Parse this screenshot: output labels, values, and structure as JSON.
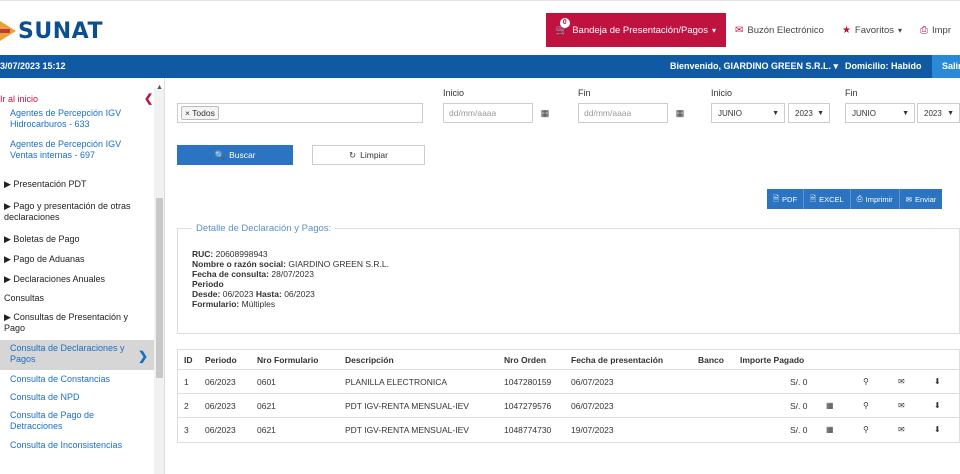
{
  "header": {
    "logo": "SUNAT",
    "nav": [
      {
        "label": "Bandeja de Presentación/Pagos",
        "badge": "0",
        "caret": "▾"
      },
      {
        "label": "Buzón Electrónico"
      },
      {
        "label": "Favoritos",
        "caret": "▾"
      },
      {
        "label": "Impr"
      }
    ]
  },
  "status": {
    "datetime": "3/07/2023 15:12",
    "welcome": "Bienvenido, GIARDINO GREEN S.R.L. ▾",
    "domicilio": "Domicilio: Habido",
    "salir": "Salir"
  },
  "sidebar": {
    "back": "Ir al inicio",
    "items": [
      {
        "label": "Agentes de Percepción IGV Hidrocarburos - 633"
      },
      {
        "label": "Agentes de Percepción IGV Ventas internas - 697"
      },
      {
        "label": "▶ Presentación PDT"
      },
      {
        "label": "▶ Pago y presentación de otras declaraciones"
      },
      {
        "label": "▶ Boletas de Pago"
      },
      {
        "label": "▶ Pago de Aduanas"
      },
      {
        "label": "▶ Declaraciones Anuales"
      },
      {
        "label": "Consultas"
      },
      {
        "label": "▶ Consultas de Presentación y Pago"
      },
      {
        "label": "Consulta de Declaraciones y Pagos"
      },
      {
        "label": "Consulta de Constancias"
      },
      {
        "label": "Consulta de NPD"
      },
      {
        "label": "Consulta de Pago de Detracciones"
      },
      {
        "label": "Consulta de Inconsistencias"
      }
    ]
  },
  "filters": {
    "tag": "× Todos",
    "inicio_label": "Inicio",
    "fin_label": "Fin",
    "inicio2_label": "Inicio",
    "fin2_label": "Fin",
    "date_placeholder": "dd/mm/aaaa",
    "month_from": "JUNIO",
    "year_from": "2023",
    "month_to": "JUNIO",
    "year_to": "2023",
    "buscar": "Buscar",
    "limpiar": "Limpiar"
  },
  "export": {
    "pdf": "PDF",
    "excel": "EXCEL",
    "imprimir": "Imprimir",
    "enviar": "Enviar"
  },
  "detail": {
    "legend": "Detalle de Declaración y Pagos:",
    "ruc_label": "RUC:",
    "ruc": "20608998943",
    "nombre_label": "Nombre o razón social:",
    "nombre": "GIARDINO GREEN S.R.L.",
    "fecha_label": "Fecha de consulta:",
    "fecha": "28/07/2023",
    "periodo_label": "Periodo",
    "desde_label": "Desde:",
    "desde": "06/2023",
    "hasta_label": "Hasta:",
    "hasta": "06/2023",
    "formulario_label": "Formulario:",
    "formulario": "Múltiples"
  },
  "table": {
    "headers": [
      "ID",
      "Periodo",
      "Nro Formulario",
      "Descripción",
      "Nro Orden",
      "Fecha de presentación",
      "Banco",
      "Importe Pagado"
    ],
    "rows": [
      {
        "id": "1",
        "periodo": "06/2023",
        "form": "0601",
        "desc": "PLANILLA ELECTRONICA",
        "orden": "1047280159",
        "fecha": "06/07/2023",
        "banco": "",
        "importe": "S/. 0"
      },
      {
        "id": "2",
        "periodo": "06/2023",
        "form": "0621",
        "desc": "PDT IGV-RENTA MENSUAL-IEV",
        "orden": "1047279576",
        "fecha": "06/07/2023",
        "banco": "",
        "importe": "S/. 0"
      },
      {
        "id": "3",
        "periodo": "06/2023",
        "form": "0621",
        "desc": "PDT IGV-RENTA MENSUAL-IEV",
        "orden": "1048774730",
        "fecha": "19/07/2023",
        "banco": "",
        "importe": "S/. 0"
      }
    ]
  }
}
